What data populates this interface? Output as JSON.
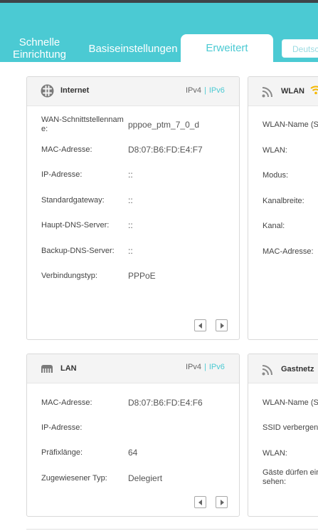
{
  "nav": {
    "tab_quick": "Schnelle Einrichtung",
    "tab_basic": "Basiseinstellungen",
    "tab_advanced": "Erweitert",
    "language": "Deutsc"
  },
  "internet": {
    "title": "Internet",
    "ipv4": "IPv4",
    "sep": "|",
    "ipv6": "IPv6",
    "rows": [
      {
        "label": "WAN-Schnittstellenname:",
        "value": "pppoe_ptm_7_0_d"
      },
      {
        "label": "MAC-Adresse:",
        "value": "D8:07:B6:FD:E4:F7"
      },
      {
        "label": "IP-Adresse:",
        "value": "::"
      },
      {
        "label": "Standardgateway:",
        "value": "::"
      },
      {
        "label": "Haupt-DNS-Server:",
        "value": "::"
      },
      {
        "label": "Backup-DNS-Server:",
        "value": "::"
      },
      {
        "label": "Verbindungstyp:",
        "value": "PPPoE"
      }
    ]
  },
  "wlan": {
    "title": "WLAN",
    "rows": [
      {
        "label": "WLAN-Name (S"
      },
      {
        "label": "WLAN:"
      },
      {
        "label": "Modus:"
      },
      {
        "label": "Kanalbreite:"
      },
      {
        "label": "Kanal:"
      },
      {
        "label": "MAC-Adresse:"
      }
    ]
  },
  "lan": {
    "title": "LAN",
    "ipv4": "IPv4",
    "sep": "|",
    "ipv6": "IPv6",
    "rows": [
      {
        "label": "MAC-Adresse:",
        "value": "D8:07:B6:FD:E4:F6"
      },
      {
        "label": "IP-Adresse:",
        "value": ""
      },
      {
        "label": "Präfixlänge:",
        "value": "64"
      },
      {
        "label": "Zugewiesener Typ:",
        "value": "Delegiert"
      }
    ]
  },
  "guest": {
    "title": "Gastnetz",
    "rows": [
      {
        "label": "WLAN-Name (S"
      },
      {
        "label": "SSID verbergen:"
      },
      {
        "label": "WLAN:"
      },
      {
        "label": "Gäste dürfen ein sehen:"
      }
    ]
  },
  "colors": {
    "accent": "#4bcad3",
    "wifi": "#f5b800"
  }
}
